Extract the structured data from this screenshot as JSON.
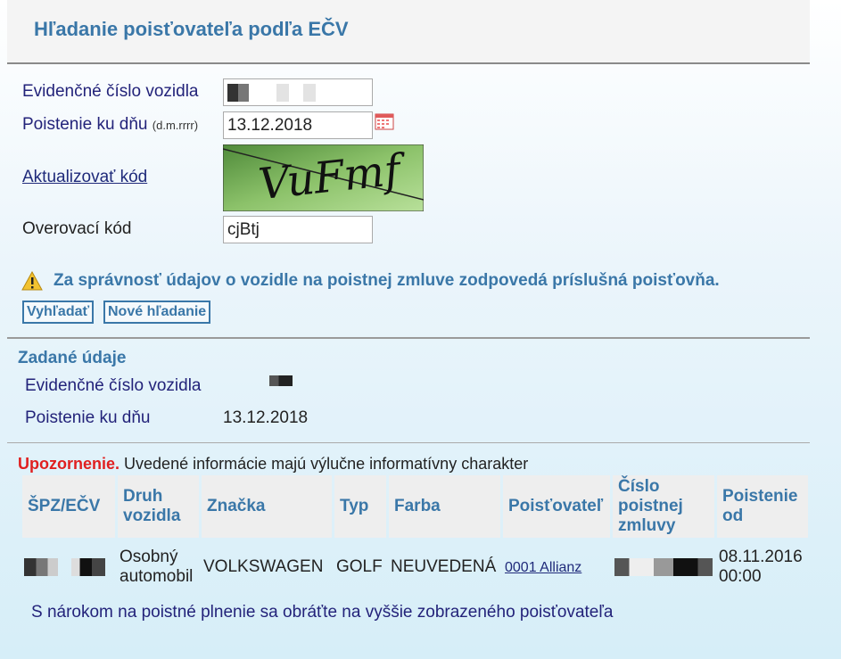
{
  "page": {
    "title": "Hľadanie poisťovateľa podľa EČV"
  },
  "form": {
    "ecv_label": "Evidenčné číslo vozidla",
    "date_label": "Poistenie ku dňu",
    "date_format_hint": "(d.m.rrrr)",
    "date_value": "13.12.2018",
    "refresh_code_link": "Aktualizovať kód",
    "captcha_text": "VuFmf",
    "verify_label": "Overovací kód",
    "verify_value": "cjBtj"
  },
  "warning": {
    "text": "Za správnosť údajov o vozidle na poistnej zmluve zodpovedá príslušná poisťovňa."
  },
  "buttons": {
    "search": "Vyhľadať",
    "new_search": "Nové hľadanie"
  },
  "entered": {
    "title": "Zadané údaje",
    "ecv_label": "Evidenčné číslo vozidla",
    "date_label": "Poistenie ku dňu",
    "date_value": "13.12.2018"
  },
  "notice": {
    "prefix": "Upozornenie.",
    "text": "Uvedené informácie majú výlučne informatívny charakter"
  },
  "table": {
    "headers": [
      "ŠPZ/EČV",
      "Druh vozidla",
      "Značka",
      "Typ",
      "Farba",
      "Poisťovateľ",
      "Číslo poistnej zmluvy",
      "Poistenie od"
    ],
    "row": {
      "druh": "Osobný automobil",
      "znacka": "VOLKSWAGEN",
      "typ": "GOLF",
      "farba": "NEUVEDENÁ",
      "poistovatel": "0001 Allianz",
      "poistenie_od": "08.11.2016 00:00"
    }
  },
  "footer": {
    "note": "S nárokom na poistné plnenie sa obráťte na vyššie zobrazeného poisťovateľa"
  },
  "colors": {
    "accent": "#3a77a8",
    "warning": "#e02020",
    "link": "#1f2a7a"
  }
}
